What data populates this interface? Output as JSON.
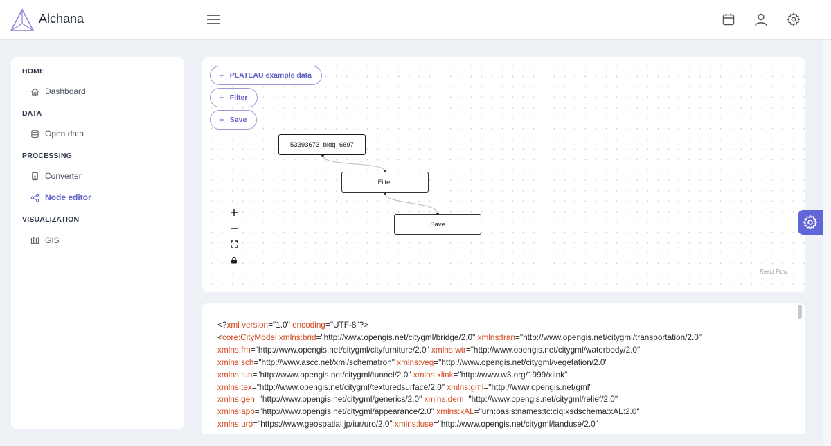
{
  "app": {
    "title": "Alchana"
  },
  "sidebar": {
    "sections": [
      {
        "title": "HOME",
        "items": [
          {
            "label": "Dashboard",
            "icon": "home-icon"
          }
        ]
      },
      {
        "title": "DATA",
        "items": [
          {
            "label": "Open data",
            "icon": "database-icon"
          }
        ]
      },
      {
        "title": "PROCESSING",
        "items": [
          {
            "label": "Converter",
            "icon": "document-icon"
          },
          {
            "label": "Node editor",
            "icon": "share-nodes-icon",
            "active": true
          }
        ]
      },
      {
        "title": "VISUALIZATION",
        "items": [
          {
            "label": "GIS",
            "icon": "map-icon"
          }
        ]
      }
    ]
  },
  "flow": {
    "buttons": [
      "PLATEAU example data",
      "Filter",
      "Save"
    ],
    "nodes": [
      "53393673_bldg_6697",
      "Filter",
      "Save"
    ],
    "attribution": "React Flow"
  },
  "code_lines": [
    [
      [
        "t",
        "<?"
      ],
      [
        "k",
        "xml version"
      ],
      [
        "t",
        "=\"1.0\" "
      ],
      [
        "k",
        "encoding"
      ],
      [
        "t",
        "=\"UTF-8\"?>"
      ]
    ],
    [
      [
        "t",
        "<"
      ],
      [
        "k",
        "core:CityModel xmlns:brid"
      ],
      [
        "t",
        "=\"http://www.opengis.net/citygml/bridge/2.0\" "
      ],
      [
        "k",
        "xmlns:tran"
      ],
      [
        "t",
        "=\"http://www.opengis.net/citygml/transportation/2.0\""
      ]
    ],
    [
      [
        "k",
        "xmlns:frn"
      ],
      [
        "t",
        "=\"http://www.opengis.net/citygml/cityfurniture/2.0\" "
      ],
      [
        "k",
        "xmlns:wtr"
      ],
      [
        "t",
        "=\"http://www.opengis.net/citygml/waterbody/2.0\""
      ]
    ],
    [
      [
        "k",
        "xmlns:sch"
      ],
      [
        "t",
        "=\"http://www.ascc.net/xml/schematron\" "
      ],
      [
        "k",
        "xmlns:veg"
      ],
      [
        "t",
        "=\"http://www.opengis.net/citygml/vegetation/2.0\""
      ]
    ],
    [
      [
        "k",
        "xmlns:tun"
      ],
      [
        "t",
        "=\"http://www.opengis.net/citygml/tunnel/2.0\" "
      ],
      [
        "k",
        "xmlns:xlink"
      ],
      [
        "t",
        "=\"http://www.w3.org/1999/xlink\""
      ]
    ],
    [
      [
        "k",
        "xmlns:tex"
      ],
      [
        "t",
        "=\"http://www.opengis.net/citygml/texturedsurface/2.0\" "
      ],
      [
        "k",
        "xmlns:gml"
      ],
      [
        "t",
        "=\"http://www.opengis.net/gml\""
      ]
    ],
    [
      [
        "k",
        "xmlns:gen"
      ],
      [
        "t",
        "=\"http://www.opengis.net/citygml/generics/2.0\" "
      ],
      [
        "k",
        "xmlns:dem"
      ],
      [
        "t",
        "=\"http://www.opengis.net/citygml/relief/2.0\""
      ]
    ],
    [
      [
        "k",
        "xmlns:app"
      ],
      [
        "t",
        "=\"http://www.opengis.net/citygml/appearance/2.0\" "
      ],
      [
        "k",
        "xmlns:xAL"
      ],
      [
        "t",
        "=\"urn:oasis:names:tc:ciq:xsdschema:xAL:2.0\""
      ]
    ],
    [
      [
        "k",
        "xmlns:uro"
      ],
      [
        "t",
        "=\"https://www.geospatial.jp/iur/uro/2.0\" "
      ],
      [
        "k",
        "xmlns:luse"
      ],
      [
        "t",
        "=\"http://www.opengis.net/citygml/landuse/2.0\""
      ]
    ]
  ]
}
